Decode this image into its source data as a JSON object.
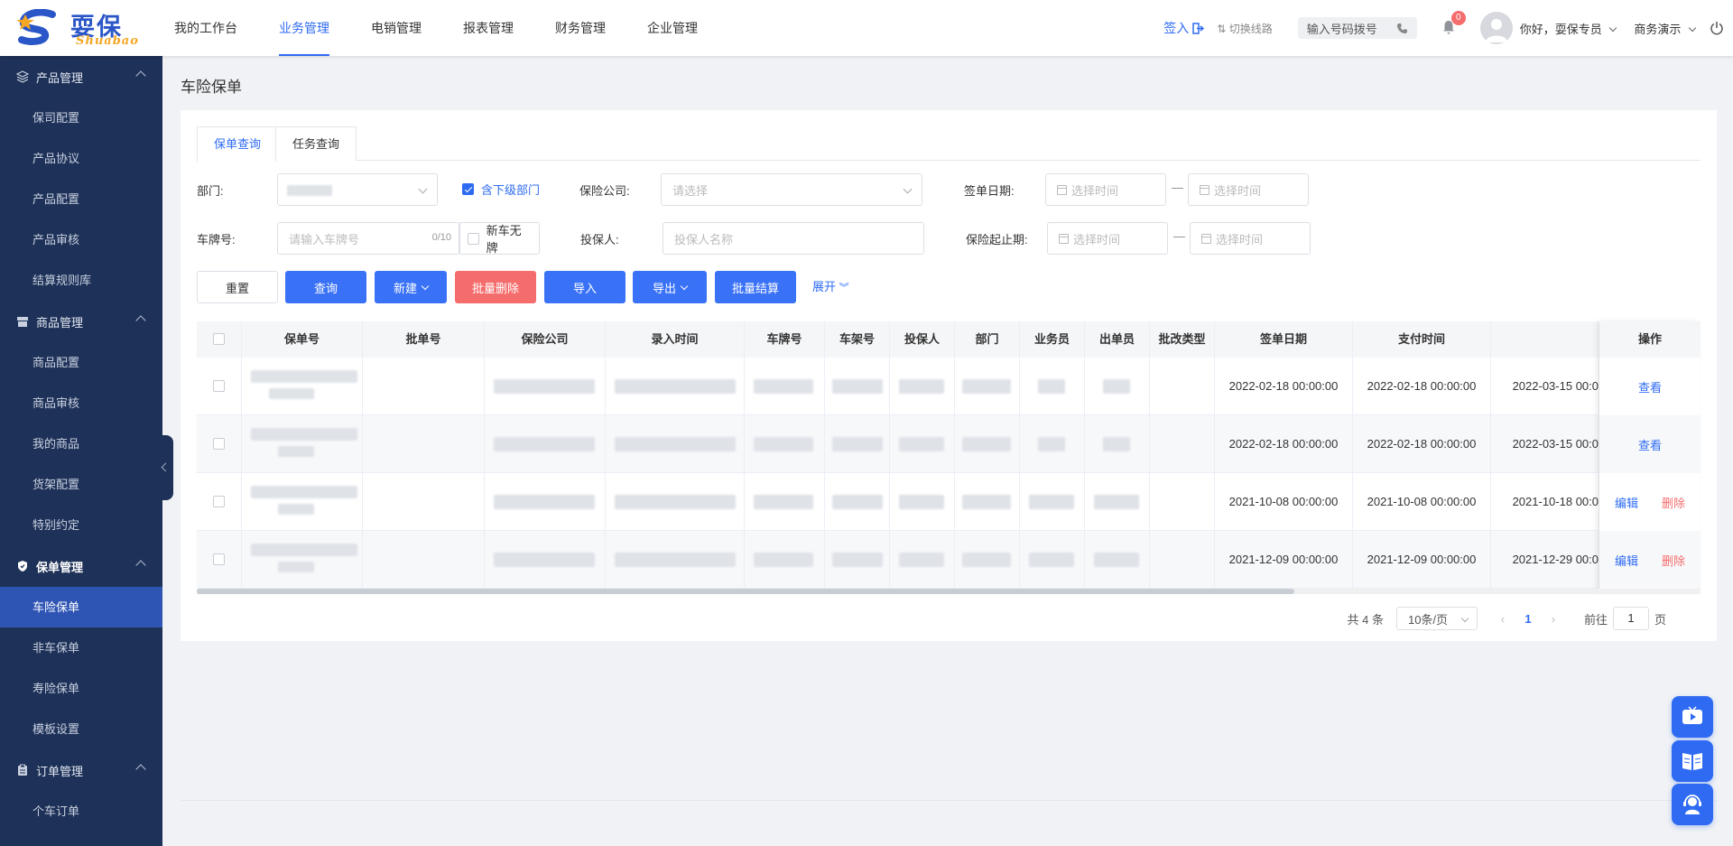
{
  "app": {
    "brand": "耍保",
    "brand_sub": "Shuabao"
  },
  "nav": [
    "我的工作台",
    "业务管理",
    "电销管理",
    "报表管理",
    "财务管理",
    "企业管理"
  ],
  "topbar": {
    "signin": "签入",
    "switch_line": "切换线路",
    "dial_placeholder": "输入号码拨号",
    "notifications": "0",
    "greeting": "你好，耍保专员",
    "company": "商务演示"
  },
  "sidebar": {
    "groups": [
      {
        "label": "产品管理",
        "items": [
          "保司配置",
          "产品协议",
          "产品配置",
          "产品审核",
          "结算规则库"
        ]
      },
      {
        "label": "商品管理",
        "items": [
          "商品配置",
          "商品审核",
          "我的商品",
          "货架配置",
          "特别约定"
        ]
      },
      {
        "label": "保单管理",
        "items": [
          "车险保单",
          "非车保单",
          "寿险保单",
          "模板设置"
        ]
      },
      {
        "label": "订单管理",
        "items": [
          "个车订单"
        ]
      }
    ],
    "active_item": "车险保单"
  },
  "page": {
    "title": "车险保单",
    "tabs": [
      "保单查询",
      "任务查询"
    ]
  },
  "filters": {
    "dept_label": "部门:",
    "include_sub_label": "含下级部门",
    "insurer_label": "保险公司:",
    "insurer_placeholder": "请选择",
    "sign_date_label": "签单日期:",
    "date_placeholder": "选择时间",
    "plate_label": "车牌号:",
    "plate_placeholder": "请输入车牌号",
    "plate_counter": "0/10",
    "new_car_label": "新车无牌",
    "policyholder_label": "投保人:",
    "policyholder_placeholder": "投保人名称",
    "period_label": "保险起止期:"
  },
  "buttons": {
    "reset": "重置",
    "search": "查询",
    "new": "新建",
    "batch_delete": "批量删除",
    "import": "导入",
    "export": "导出",
    "batch_settle": "批量结算",
    "expand": "展开"
  },
  "table": {
    "columns": [
      "保单号",
      "批单号",
      "保险公司",
      "录入时间",
      "车牌号",
      "车架号",
      "投保人",
      "部门",
      "业务员",
      "出单员",
      "批改类型",
      "签单日期",
      "支付时间"
    ],
    "ops_header": "操作",
    "rows": [
      {
        "sign_date": "2022-02-18 00:00:00",
        "pay_time": "2022-02-18 00:00:00",
        "start": "2022-03-15 00:0",
        "ops": [
          "查看"
        ]
      },
      {
        "sign_date": "2022-02-18 00:00:00",
        "pay_time": "2022-02-18 00:00:00",
        "start": "2022-03-15 00:0",
        "ops": [
          "查看"
        ]
      },
      {
        "sign_date": "2021-10-08 00:00:00",
        "pay_time": "2021-10-08 00:00:00",
        "start": "2021-10-18 00:0",
        "ops": [
          "编辑",
          "删除"
        ]
      },
      {
        "sign_date": "2021-12-09 00:00:00",
        "pay_time": "2021-12-09 00:00:00",
        "start": "2021-12-29 00:0",
        "ops": [
          "编辑",
          "删除"
        ]
      }
    ]
  },
  "pagination": {
    "total": "共 4 条",
    "page_size": "10条/页",
    "current": "1",
    "goto_prefix": "前往",
    "goto_value": "1",
    "goto_suffix": "页"
  },
  "colors": {
    "primary": "#2f6bf2",
    "sidebar": "#1e3158",
    "sidebar_active": "#2f55b4",
    "danger": "#f56c6c"
  }
}
